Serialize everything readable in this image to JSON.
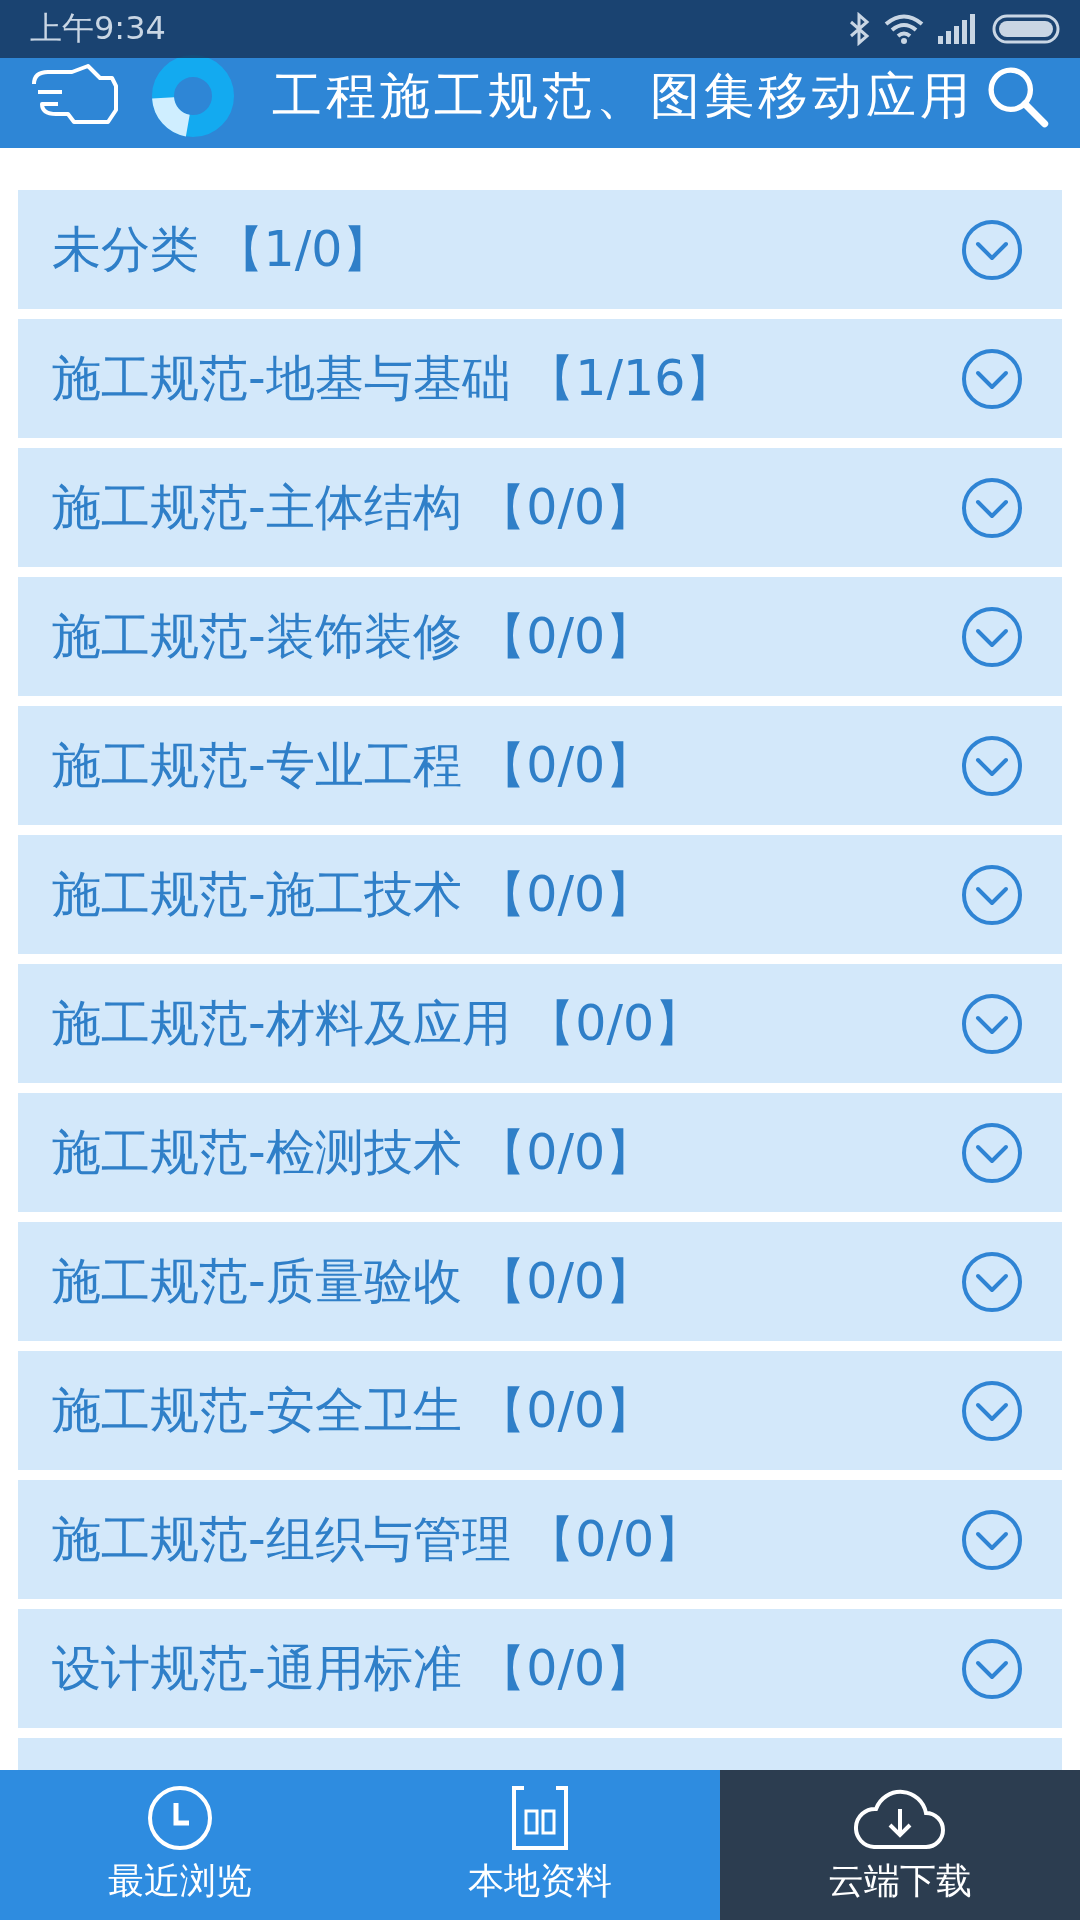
{
  "status_bar": {
    "time": "上午9:34"
  },
  "header": {
    "title": "工程施工规范、图集移动应用"
  },
  "categories": [
    {
      "label": "未分类",
      "count": "【1/0】",
      "expanded": false
    },
    {
      "label": "施工规范-地基与基础",
      "count": "【1/16】",
      "expanded": false
    },
    {
      "label": "施工规范-主体结构",
      "count": "【0/0】",
      "expanded": false
    },
    {
      "label": "施工规范-装饰装修",
      "count": "【0/0】",
      "expanded": false
    },
    {
      "label": "施工规范-专业工程",
      "count": "【0/0】",
      "expanded": false
    },
    {
      "label": "施工规范-施工技术",
      "count": "【0/0】",
      "expanded": false
    },
    {
      "label": "施工规范-材料及应用",
      "count": "【0/0】",
      "expanded": false
    },
    {
      "label": "施工规范-检测技术",
      "count": "【0/0】",
      "expanded": false
    },
    {
      "label": "施工规范-质量验收",
      "count": "【0/0】",
      "expanded": false
    },
    {
      "label": "施工规范-安全卫生",
      "count": "【0/0】",
      "expanded": false
    },
    {
      "label": "施工规范-组织与管理",
      "count": "【0/0】",
      "expanded": false
    },
    {
      "label": "设计规范-通用标准",
      "count": "【0/0】",
      "expanded": false
    }
  ],
  "bottom_nav": [
    {
      "kind": "recent",
      "label": "最近浏览",
      "selected": false
    },
    {
      "kind": "local",
      "label": "本地资料",
      "selected": false
    },
    {
      "kind": "cloud",
      "label": "云端下载",
      "selected": true
    }
  ]
}
